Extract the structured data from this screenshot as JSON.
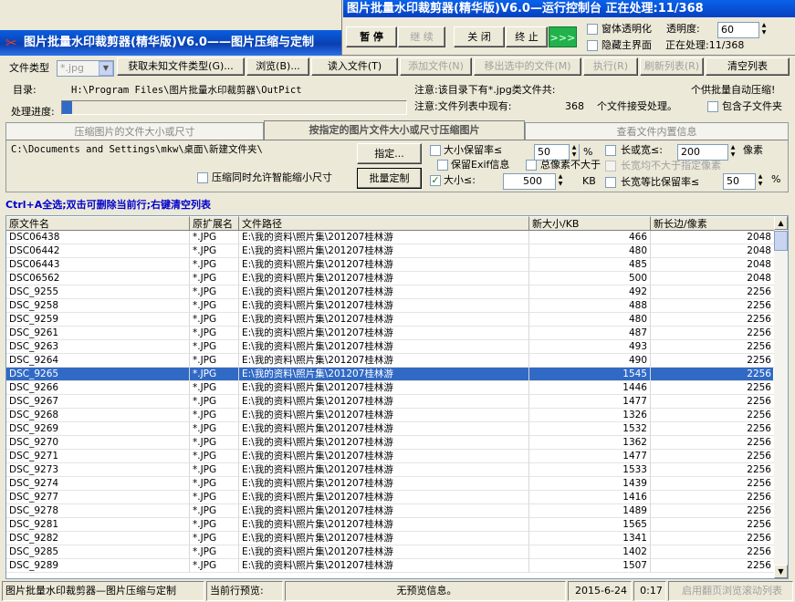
{
  "control_panel": {
    "title": "图片批量水印裁剪器(精华版)V6.0—运行控制台 正在处理:11/368",
    "pause": "暂 停",
    "resume": "继 续",
    "close": "关 闭",
    "stop": "终 止",
    "go": ">>>",
    "window_transparent": "窗体透明化",
    "transparency_label": "透明度:",
    "transparency_value": "60",
    "hide_main": "隐藏主界面",
    "processing": "正在处理:11/368"
  },
  "main_window": {
    "title": "图片批量水印裁剪器(精华版)V6.0——图片压缩与定制"
  },
  "toolbar": {
    "file_type_label": "文件类型",
    "file_type_value": "*.jpg",
    "get_unknown": "获取未知文件类型(G)...",
    "browse": "浏览(B)...",
    "read_file": "读入文件(T)",
    "add_file": "添加文件(N)",
    "remove_selected": "移出选中的文件(M)",
    "execute": "执行(R)",
    "refresh": "刷新列表(R)",
    "clear": "清空列表"
  },
  "info": {
    "dir_label": "目录:",
    "dir_value": "H:\\Program Files\\图片批量水印裁剪器\\OutPict",
    "note1": "注意:该目录下有*.jpg类文件共:",
    "batch_note": "个供批量自动压缩!",
    "progress_label": "处理进度:",
    "progress_fraction": 0.03,
    "note2": "注意:文件列表中现有:",
    "count": "368",
    "accept_note": "个文件接受处理。",
    "include_sub": "包含子文件夹"
  },
  "tabs": [
    {
      "label": "压缩图片的文件大小或尺寸",
      "active": false
    },
    {
      "label": "按指定的图片文件大小或尺寸压缩图片",
      "active": true
    },
    {
      "label": "查看文件内置信息",
      "active": false
    }
  ],
  "options": {
    "output_path": "C:\\Documents and Settings\\mkw\\桌面\\新建文件夹\\",
    "specify": "指定...",
    "batch": "批量定制",
    "smart_shrink": "压缩同时允许智能缩小尺寸",
    "size_keep_rate": "大小保留率≤",
    "size_keep_value": "50",
    "percent": "%",
    "long_or_wide": "长或宽≤:",
    "lw_value": "200",
    "pixel": "像素",
    "keep_exif": "保留Exif信息",
    "total_pixels": "总像素不大于",
    "lw_not_exceed": "长宽均不大于指定像素",
    "size_le": "大小≤:",
    "size_value": "500",
    "kb": "KB",
    "ratio_keep": "长宽等比保留率≤",
    "ratio_value": "50",
    "percent2": "%"
  },
  "hint": "Ctrl+A全选;双击可删除当前行;右键清空列表",
  "table": {
    "headers": [
      "原文件名",
      "原扩展名",
      "文件路径",
      "新大小/KB",
      "新长边/像素"
    ],
    "rows": [
      [
        "DSC06438",
        "*.JPG",
        "E:\\我的资料\\照片集\\201207桂林游",
        "466",
        "2048"
      ],
      [
        "DSC06442",
        "*.JPG",
        "E:\\我的资料\\照片集\\201207桂林游",
        "480",
        "2048"
      ],
      [
        "DSC06443",
        "*.JPG",
        "E:\\我的资料\\照片集\\201207桂林游",
        "485",
        "2048"
      ],
      [
        "DSC06562",
        "*.JPG",
        "E:\\我的资料\\照片集\\201207桂林游",
        "500",
        "2048"
      ],
      [
        "DSC_9255",
        "*.JPG",
        "E:\\我的资料\\照片集\\201207桂林游",
        "492",
        "2256"
      ],
      [
        "DSC_9258",
        "*.JPG",
        "E:\\我的资料\\照片集\\201207桂林游",
        "488",
        "2256"
      ],
      [
        "DSC_9259",
        "*.JPG",
        "E:\\我的资料\\照片集\\201207桂林游",
        "480",
        "2256"
      ],
      [
        "DSC_9261",
        "*.JPG",
        "E:\\我的资料\\照片集\\201207桂林游",
        "487",
        "2256"
      ],
      [
        "DSC_9263",
        "*.JPG",
        "E:\\我的资料\\照片集\\201207桂林游",
        "493",
        "2256"
      ],
      [
        "DSC_9264",
        "*.JPG",
        "E:\\我的资料\\照片集\\201207桂林游",
        "490",
        "2256"
      ],
      [
        "DSC_9265",
        "*.JPG",
        "E:\\我的资料\\照片集\\201207桂林游",
        "1545",
        "2256"
      ],
      [
        "DSC_9266",
        "*.JPG",
        "E:\\我的资料\\照片集\\201207桂林游",
        "1446",
        "2256"
      ],
      [
        "DSC_9267",
        "*.JPG",
        "E:\\我的资料\\照片集\\201207桂林游",
        "1477",
        "2256"
      ],
      [
        "DSC_9268",
        "*.JPG",
        "E:\\我的资料\\照片集\\201207桂林游",
        "1326",
        "2256"
      ],
      [
        "DSC_9269",
        "*.JPG",
        "E:\\我的资料\\照片集\\201207桂林游",
        "1532",
        "2256"
      ],
      [
        "DSC_9270",
        "*.JPG",
        "E:\\我的资料\\照片集\\201207桂林游",
        "1362",
        "2256"
      ],
      [
        "DSC_9271",
        "*.JPG",
        "E:\\我的资料\\照片集\\201207桂林游",
        "1477",
        "2256"
      ],
      [
        "DSC_9273",
        "*.JPG",
        "E:\\我的资料\\照片集\\201207桂林游",
        "1533",
        "2256"
      ],
      [
        "DSC_9274",
        "*.JPG",
        "E:\\我的资料\\照片集\\201207桂林游",
        "1439",
        "2256"
      ],
      [
        "DSC_9277",
        "*.JPG",
        "E:\\我的资料\\照片集\\201207桂林游",
        "1416",
        "2256"
      ],
      [
        "DSC_9278",
        "*.JPG",
        "E:\\我的资料\\照片集\\201207桂林游",
        "1489",
        "2256"
      ],
      [
        "DSC_9281",
        "*.JPG",
        "E:\\我的资料\\照片集\\201207桂林游",
        "1565",
        "2256"
      ],
      [
        "DSC_9282",
        "*.JPG",
        "E:\\我的资料\\照片集\\201207桂林游",
        "1341",
        "2256"
      ],
      [
        "DSC_9285",
        "*.JPG",
        "E:\\我的资料\\照片集\\201207桂林游",
        "1402",
        "2256"
      ],
      [
        "DSC_9289",
        "*.JPG",
        "E:\\我的资料\\照片集\\201207桂林游",
        "1507",
        "2256"
      ]
    ],
    "selected_row": 10
  },
  "statusbar": {
    "app": "图片批量水印裁剪器—图片压缩与定制",
    "preview_label": "当前行预览:",
    "preview_value": "无预览信息。",
    "date": "2015-6-24",
    "time": "0:17",
    "scroll_toggle": "启用翻页浏览滚动列表"
  },
  "colors": {
    "title": "#0a4fd0",
    "selection": "#316ac5",
    "hint": "#0000cc",
    "go": "#22b14c"
  }
}
